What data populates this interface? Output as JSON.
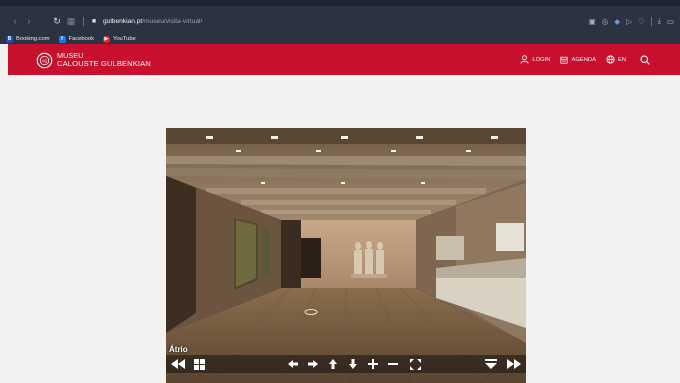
{
  "browser": {
    "url_host": "gulbenkian.pt",
    "url_path": "/museu/visita-virtual/",
    "bookmarks": [
      {
        "label": "Booking.com",
        "icon": "booking-icon",
        "initial": "B"
      },
      {
        "label": "Facebook",
        "icon": "facebook-icon",
        "initial": "f"
      },
      {
        "label": "YouTube",
        "icon": "youtube-icon",
        "initial": "▶"
      }
    ]
  },
  "header": {
    "logo_line1": "MUSEU",
    "logo_line2": "CALOUSTE GULBENKIAN",
    "nav": {
      "login": "LOGIN",
      "agenda": "AGENDA",
      "language": "EN"
    },
    "brand_color": "#c8102e"
  },
  "tour": {
    "scene_name": "Átrio",
    "controls": [
      "rewind-icon",
      "thumbnails-grid-icon",
      "pan-left-icon",
      "pan-right-icon",
      "pan-up-icon",
      "pan-down-icon",
      "zoom-in-icon",
      "zoom-out-icon",
      "fullscreen-icon",
      "collapse-down-icon",
      "fast-forward-icon"
    ]
  }
}
